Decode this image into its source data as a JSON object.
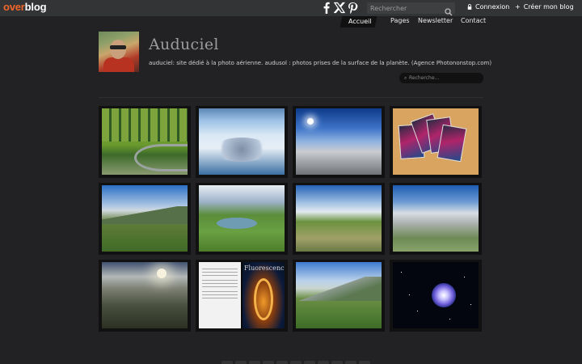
{
  "topbar": {
    "logo_part1": "over",
    "logo_part2": "blog",
    "social": [
      {
        "icon": "facebook-icon"
      },
      {
        "icon": "x-icon"
      },
      {
        "icon": "pinterest-icon"
      }
    ],
    "search_placeholder": "Rechercher",
    "login_label": "Connexion",
    "create_label": "Créer mon blog"
  },
  "nav": {
    "items": [
      "Accueil",
      "Pages",
      "Newsletter",
      "Contact"
    ],
    "active": "Accueil"
  },
  "header": {
    "title": "Auduciel",
    "description": "auduciel: site dédié à la photo aérienne. audusol : photos prises de la surface de la planète. (Agence Photononstop.com)",
    "search_placeholder": "Recherche..."
  },
  "gallery": {
    "tiles": [
      {
        "subject": "aerial-green-fields-and-road"
      },
      {
        "subject": "aerial-snowy-town"
      },
      {
        "subject": "aerial-clouds-and-sky"
      },
      {
        "subject": "book-covers-fan"
      },
      {
        "subject": "aerial-mountain-valley"
      },
      {
        "subject": "aerial-mountain-lake"
      },
      {
        "subject": "aerial-mountain-plateau"
      },
      {
        "subject": "aerial-snowy-peaks"
      },
      {
        "subject": "aerial-misty-sunrise"
      },
      {
        "subject": "fluorescence-book-cover"
      },
      {
        "subject": "aerial-green-ridge"
      },
      {
        "subject": "nebula-space-image"
      }
    ],
    "fluorescence_title": "Fluorescence"
  },
  "colors": {
    "background": "#222224",
    "topbar": "#333436",
    "brand_orange": "#f1672a"
  }
}
